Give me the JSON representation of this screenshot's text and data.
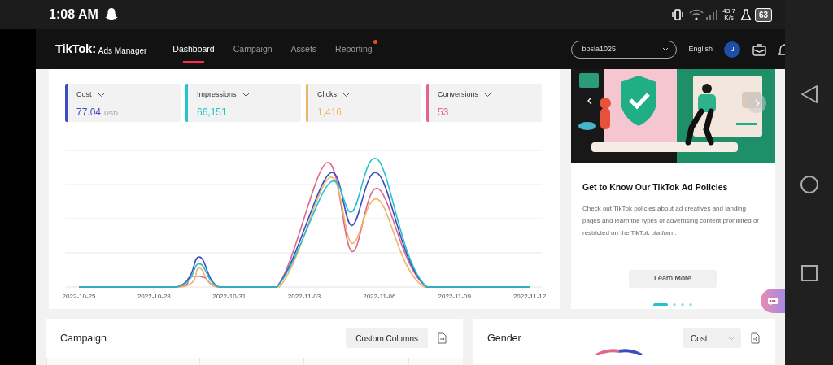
{
  "status_bar": {
    "time": "1:08 AM",
    "speed_value": "43.7",
    "speed_unit": "K/s",
    "battery": "63"
  },
  "navbar": {
    "logo": "TikTok:",
    "product": "Ads Manager",
    "tabs": [
      {
        "label": "Dashboard",
        "selected": true,
        "badge": false
      },
      {
        "label": "Campaign",
        "selected": false,
        "badge": false
      },
      {
        "label": "Assets",
        "selected": false,
        "badge": false
      },
      {
        "label": "Reporting",
        "selected": false,
        "badge": true
      }
    ],
    "account": "bosla1025",
    "language": "English",
    "avatar": "u"
  },
  "metrics": [
    {
      "label": "Cost",
      "value": "77.04",
      "unit": "USD",
      "color": "#3b4cc0"
    },
    {
      "label": "Impressions",
      "value": "66,151",
      "color": "#25c2cc"
    },
    {
      "label": "Clicks",
      "value": "1,416",
      "color": "#f0b36a"
    },
    {
      "label": "Conversions",
      "value": "53",
      "color": "#e0668a"
    }
  ],
  "chart": {
    "x_labels": [
      "2022-10-25",
      "2022-10-28",
      "2022-10-31",
      "2022-11-03",
      "2022-11-06",
      "2022-11-09",
      "2022-11-12"
    ]
  },
  "promo": {
    "title": "Get to Know Our TikTok Ad Policies",
    "body": "Check out TikTok policies about ad creatives and landing pages and learn the types of advertising content prohibited or restricted on the TikTok platform.",
    "button": "Learn More",
    "dots": [
      {
        "selected": true
      },
      {
        "selected": false
      },
      {
        "selected": false
      },
      {
        "selected": false
      }
    ]
  },
  "campaign": {
    "title": "Campaign",
    "button": "Custom Columns"
  },
  "gender": {
    "title": "Gender",
    "select": "Cost"
  }
}
